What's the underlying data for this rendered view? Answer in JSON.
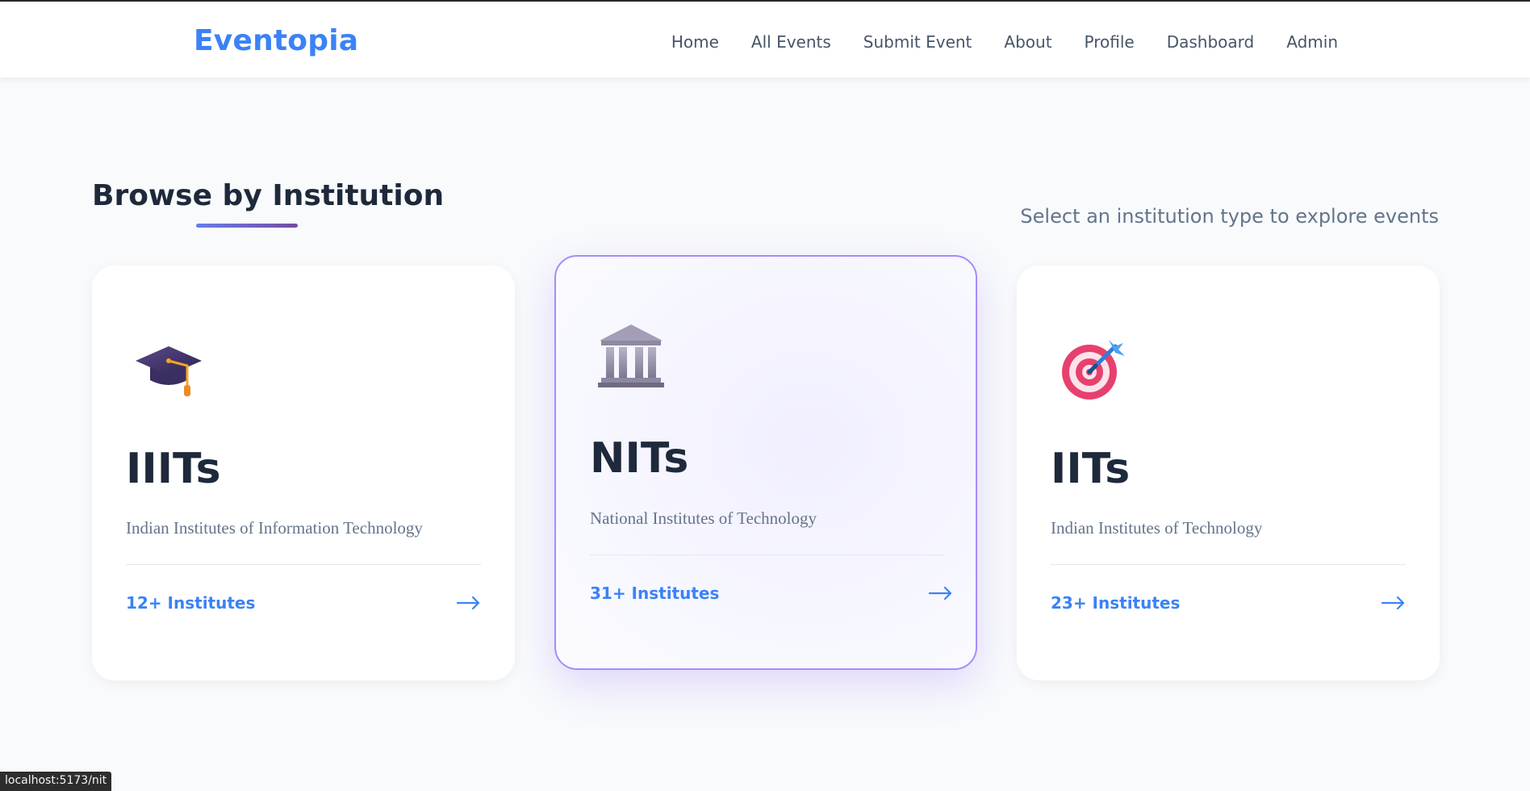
{
  "app": {
    "brand": "Eventopia"
  },
  "nav": {
    "items": [
      {
        "label": "Home"
      },
      {
        "label": "All Events"
      },
      {
        "label": "Submit Event"
      },
      {
        "label": "About"
      },
      {
        "label": "Profile"
      },
      {
        "label": "Dashboard"
      },
      {
        "label": "Admin"
      }
    ]
  },
  "section": {
    "title": "Browse by Institution",
    "subtitle": "Select an institution type to explore events"
  },
  "cards": [
    {
      "icon": "graduation-cap-icon",
      "name": "IIITs",
      "description": "Indian Institutes of Information Technology",
      "count": "12+ Institutes"
    },
    {
      "icon": "classical-building-icon",
      "name": "NITs",
      "description": "National Institutes of Technology",
      "count": "31+ Institutes",
      "state": "hovered"
    },
    {
      "icon": "target-dart-icon",
      "name": "IITs",
      "description": "Indian Institutes of Technology",
      "count": "23+ Institutes"
    }
  ],
  "status_bar": {
    "url": "localhost:5173/nit"
  },
  "colors": {
    "brand": "#3b82f6",
    "accent": "#8b5cf6",
    "title": "#1e293b",
    "muted": "#64748b"
  }
}
